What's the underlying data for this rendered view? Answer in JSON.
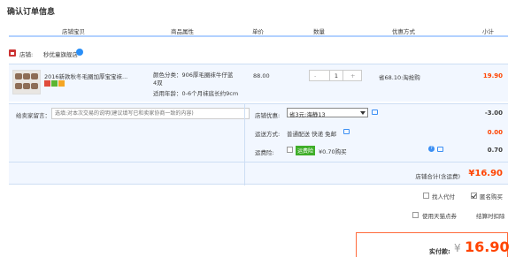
{
  "page_title": "确认订单信息",
  "columns": [
    "店铺宝贝",
    "商品属性",
    "单价",
    "数量",
    "优惠方式",
    "小计"
  ],
  "shop": {
    "label": "店铺:",
    "name": "秒优童旗舰店"
  },
  "item": {
    "title": "2016新款秋冬毛圈加厚宝宝袜...",
    "attr_color": "颜色分类：906厚毛圈袜牛仔蓝4双",
    "attr_age": "适用年龄：0-6个月袜底长约9cm",
    "price": "88.00",
    "qty_minus": "-",
    "quantity": "1",
    "qty_plus": "+",
    "promo": "省68.10:淘抢购",
    "subtotal": "19.90"
  },
  "note": {
    "label": "给卖家留言：",
    "placeholder": "选填:对本次交易的说明(建议填写已和卖家协商一致的内容)"
  },
  "shop_discount": {
    "label": "店铺优惠:",
    "selected": "省3元:海静13",
    "value": "-3.00"
  },
  "delivery": {
    "label": "运送方式:",
    "text": "普通配送 快递 免邮",
    "value": "0.00"
  },
  "insurance": {
    "label": "运费险:",
    "badge": "运费险",
    "text": "¥0.70购买",
    "help": "?",
    "value": "0.70"
  },
  "shop_total": {
    "label": "店铺合计(含运费)",
    "value": "¥16.90"
  },
  "options": {
    "pay_for_me": "找人代付",
    "anonymous": "匿名购买",
    "use_tmall_points": "使用天猫点券",
    "settle_deduct": "结算时扣除"
  },
  "payment": {
    "label": "实付款:",
    "currency": "¥",
    "value": "16.90"
  },
  "colors": {
    "accent": "#ff4400",
    "row_bg": "#f2f7ff",
    "header_border": "#b2d1ff"
  }
}
